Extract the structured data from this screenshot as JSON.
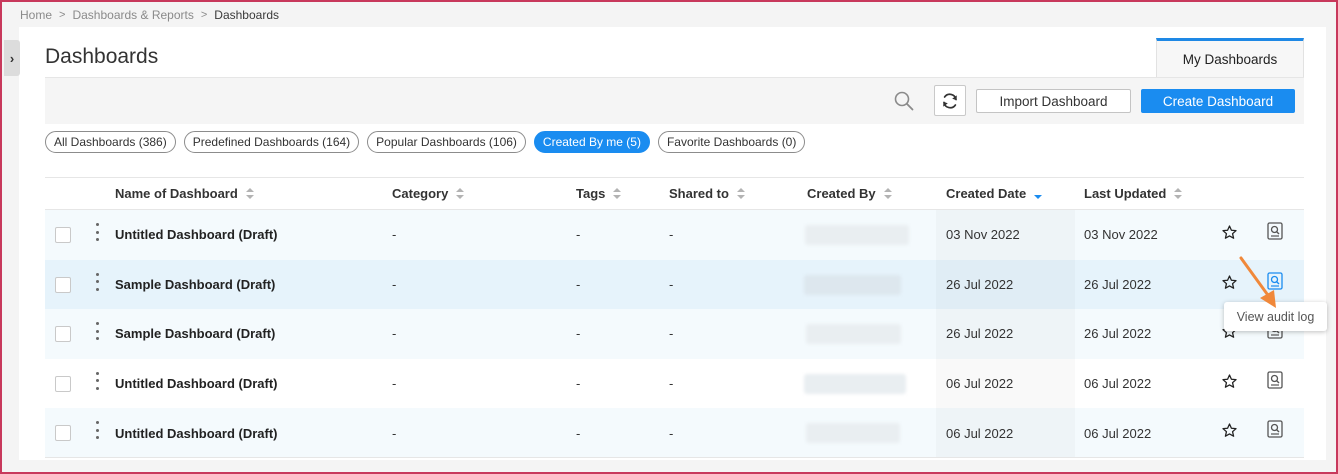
{
  "breadcrumb": {
    "items": [
      "Home",
      "Dashboards & Reports",
      "Dashboards"
    ]
  },
  "page": {
    "title": "Dashboards"
  },
  "tabs": {
    "my_dashboards": "My Dashboards"
  },
  "toolbar": {
    "import_label": "Import Dashboard",
    "create_label": "Create Dashboard"
  },
  "filters": [
    {
      "label": "All Dashboards (386)",
      "active": false
    },
    {
      "label": "Predefined Dashboards (164)",
      "active": false
    },
    {
      "label": "Popular Dashboards (106)",
      "active": false
    },
    {
      "label": "Created By me (5)",
      "active": true
    },
    {
      "label": "Favorite Dashboards (0)",
      "active": false
    }
  ],
  "table": {
    "columns": {
      "name": "Name of Dashboard",
      "category": "Category",
      "tags": "Tags",
      "shared_to": "Shared to",
      "created_by": "Created By",
      "created_date": "Created Date",
      "last_updated": "Last Updated"
    },
    "sorted_column": "created_date",
    "rows": [
      {
        "name": "Untitled Dashboard (Draft)",
        "category": "-",
        "tags": "-",
        "shared_to": "-",
        "created_date": "03 Nov 2022",
        "last_updated": "03 Nov 2022"
      },
      {
        "name": "Sample Dashboard (Draft)",
        "category": "-",
        "tags": "-",
        "shared_to": "-",
        "created_date": "26 Jul 2022",
        "last_updated": "26 Jul 2022"
      },
      {
        "name": "Sample Dashboard (Draft)",
        "category": "-",
        "tags": "-",
        "shared_to": "-",
        "created_date": "26 Jul 2022",
        "last_updated": "26 Jul 2022"
      },
      {
        "name": "Untitled Dashboard (Draft)",
        "category": "-",
        "tags": "-",
        "shared_to": "-",
        "created_date": "06 Jul 2022",
        "last_updated": "06 Jul 2022"
      },
      {
        "name": "Untitled Dashboard (Draft)",
        "category": "-",
        "tags": "-",
        "shared_to": "-",
        "created_date": "06 Jul 2022",
        "last_updated": "06 Jul 2022"
      }
    ]
  },
  "tooltip": {
    "text": "View audit log"
  },
  "icons": {
    "search": "search-icon",
    "refresh": "refresh-icon",
    "favorite": "star-icon",
    "audit_log": "audit-log-icon",
    "expand": "chevron-right-icon",
    "row_menu": "kebab-menu-icon"
  },
  "colors": {
    "accent": "#1a8cf0",
    "frame": "#c8395c",
    "annotation_arrow": "#f0883a"
  }
}
